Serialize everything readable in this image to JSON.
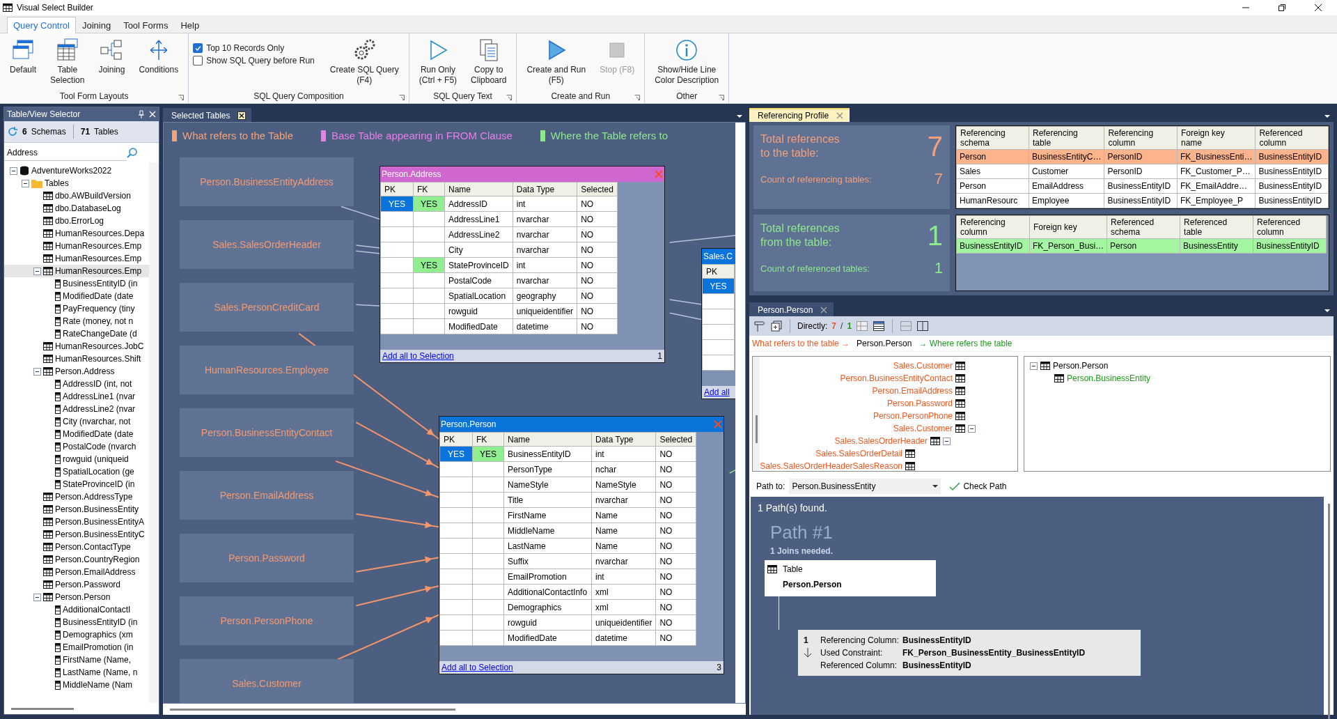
{
  "window": {
    "title": "Visual Select Builder"
  },
  "ribbon": {
    "tabs": [
      {
        "label": "Query Control",
        "selected": true
      },
      {
        "label": "Joining",
        "selected": false
      },
      {
        "label": "Tool Forms",
        "selected": false
      },
      {
        "label": "Help",
        "selected": false
      }
    ],
    "groups": [
      {
        "label": "Tool Form Layouts",
        "items": [
          {
            "kind": "button",
            "label": "Default",
            "disabled": false
          },
          {
            "kind": "button",
            "label": "Table\nSelection",
            "disabled": false
          },
          {
            "kind": "button",
            "label": "Joining",
            "disabled": false
          },
          {
            "kind": "button",
            "label": "Conditions",
            "disabled": false
          }
        ]
      },
      {
        "label": "SQL Query Composition",
        "items": [
          {
            "kind": "checkbox",
            "label": "Top 10 Records Only",
            "checked": true
          },
          {
            "kind": "checkbox",
            "label": "Show SQL Query before Run",
            "checked": false
          },
          {
            "kind": "button",
            "label": "Create SQL Query\n(F4)",
            "disabled": false
          }
        ]
      },
      {
        "label": "SQL Query Text",
        "items": [
          {
            "kind": "button",
            "label": "Run Only\n(Ctrl + F5)",
            "disabled": false
          },
          {
            "kind": "button",
            "label": "Copy to\nClipboard",
            "disabled": false
          }
        ]
      },
      {
        "label": "Create and Run",
        "items": [
          {
            "kind": "button",
            "label": "Create and Run\n(F5)",
            "disabled": false
          },
          {
            "kind": "button",
            "label": "Stop (F8)",
            "disabled": true
          }
        ]
      },
      {
        "label": "Other",
        "items": [
          {
            "kind": "button",
            "label": "Show/Hide Line\nColor Description",
            "disabled": false
          }
        ]
      }
    ]
  },
  "selector": {
    "title": "Table/View Selector",
    "schemas_count": "6",
    "schemas_label": "Schemas",
    "tables_count": "71",
    "tables_label": "Tables",
    "search": {
      "value": "Address"
    },
    "tree": [
      {
        "label": "AdventureWorks2022",
        "selected": false,
        "children": [
          {
            "label": "Tables",
            "selected": false,
            "children": [
              {
                "label": "dbo.AWBuildVersion",
                "selected": false
              },
              {
                "label": "dbo.DatabaseLog",
                "selected": false
              },
              {
                "label": "dbo.ErrorLog",
                "selected": false
              },
              {
                "label": "HumanResources.Depa",
                "selected": false
              },
              {
                "label": "HumanResources.Emp",
                "selected": false
              },
              {
                "label": "HumanResources.Emp",
                "selected": false
              },
              {
                "label": "HumanResources.Emp",
                "selected": true,
                "children": [
                  {
                    "label": "BusinessEntityID (in",
                    "selected": false
                  },
                  {
                    "label": "ModifiedDate (date",
                    "selected": false
                  },
                  {
                    "label": "PayFrequency (tiny",
                    "selected": false
                  },
                  {
                    "label": "Rate (money, not n",
                    "selected": false
                  },
                  {
                    "label": "RateChangeDate (d",
                    "selected": false
                  }
                ]
              },
              {
                "label": "HumanResources.JobC",
                "selected": false
              },
              {
                "label": "HumanResources.Shift",
                "selected": false
              },
              {
                "label": "Person.Address",
                "selected": false,
                "children": [
                  {
                    "label": "AddressID (int, not",
                    "selected": false
                  },
                  {
                    "label": "AddressLine1 (nvar",
                    "selected": false
                  },
                  {
                    "label": "AddressLine2 (nvar",
                    "selected": false
                  },
                  {
                    "label": "City (nvarchar, not",
                    "selected": false
                  },
                  {
                    "label": "ModifiedDate (date",
                    "selected": false
                  },
                  {
                    "label": "PostalCode (nvarch",
                    "selected": false
                  },
                  {
                    "label": "rowguid (uniqueid",
                    "selected": false
                  },
                  {
                    "label": "SpatialLocation (ge",
                    "selected": false
                  },
                  {
                    "label": "StateProvinceID (in",
                    "selected": false
                  }
                ]
              },
              {
                "label": "Person.AddressType",
                "selected": false
              },
              {
                "label": "Person.BusinessEntity",
                "selected": false
              },
              {
                "label": "Person.BusinessEntityA",
                "selected": false
              },
              {
                "label": "Person.BusinessEntityC",
                "selected": false
              },
              {
                "label": "Person.ContactType",
                "selected": false
              },
              {
                "label": "Person.CountryRegion",
                "selected": false
              },
              {
                "label": "Person.EmailAddress",
                "selected": false
              },
              {
                "label": "Person.Password",
                "selected": false
              },
              {
                "label": "Person.Person",
                "selected": false,
                "children": [
                  {
                    "label": "AdditionalContactI",
                    "selected": false
                  },
                  {
                    "label": "BusinessEntityID (in",
                    "selected": false
                  },
                  {
                    "label": "Demographics (xm",
                    "selected": false
                  },
                  {
                    "label": "EmailPromotion (in",
                    "selected": false
                  },
                  {
                    "label": "FirstName (Name,",
                    "selected": false
                  },
                  {
                    "label": "LastName (Name, n",
                    "selected": false
                  },
                  {
                    "label": "MiddleName (Nam",
                    "selected": false
                  }
                ]
              }
            ]
          }
        ]
      }
    ]
  },
  "center": {
    "tab": {
      "label": "Selected Tables",
      "selected": false
    },
    "legend": [
      {
        "label": "What refers to the Table",
        "color": "#f4a27a"
      },
      {
        "label": "Base Table appearing in FROM Clause",
        "color": "#e77fe7"
      },
      {
        "label": "Where the Table refers to",
        "color": "#8ee88e"
      }
    ],
    "nodes": [
      "Person.BusinessEntityAddress",
      "Sales.SalesOrderHeader",
      "Sales.PersonCreditCard",
      "HumanResources.Employee",
      "Person.BusinessEntityContact",
      "Person.EmailAddress",
      "Person.Password",
      "Person.PersonPhone",
      "Sales.Customer"
    ],
    "windows": [
      {
        "title": "Person.Address",
        "color": "#d066d0",
        "columns": [
          "PK",
          "FK",
          "Name",
          "Data Type",
          "Selected"
        ],
        "rows": [
          [
            "YES",
            "YES",
            "AddressID",
            "int",
            "NO"
          ],
          [
            "",
            "",
            "AddressLine1",
            "nvarchar",
            "NO"
          ],
          [
            "",
            "",
            "AddressLine2",
            "nvarchar",
            "NO"
          ],
          [
            "",
            "",
            "City",
            "nvarchar",
            "NO"
          ],
          [
            "",
            "YES",
            "StateProvinceID",
            "int",
            "NO"
          ],
          [
            "",
            "",
            "PostalCode",
            "nvarchar",
            "NO"
          ],
          [
            "",
            "",
            "SpatialLocation",
            "geography",
            "NO"
          ],
          [
            "",
            "",
            "rowguid",
            "uniqueidentifier",
            "NO"
          ],
          [
            "",
            "",
            "ModifiedDate",
            "datetime",
            "NO"
          ]
        ],
        "link": "Add all to Selection",
        "count": "1"
      },
      {
        "title": "Sales.C",
        "color": "#0a74da",
        "columns": [
          "PK"
        ],
        "rows": [
          [
            "YES"
          ]
        ],
        "link": "Add all"
      },
      {
        "title": "Person.Person",
        "color": "#0a74da",
        "columns": [
          "PK",
          "FK",
          "Name",
          "Data Type",
          "Selected"
        ],
        "rows": [
          [
            "YES",
            "YES",
            "BusinessEntityID",
            "int",
            "NO"
          ],
          [
            "",
            "",
            "PersonType",
            "nchar",
            "NO"
          ],
          [
            "",
            "",
            "NameStyle",
            "NameStyle",
            "NO"
          ],
          [
            "",
            "",
            "Title",
            "nvarchar",
            "NO"
          ],
          [
            "",
            "",
            "FirstName",
            "Name",
            "NO"
          ],
          [
            "",
            "",
            "MiddleName",
            "Name",
            "NO"
          ],
          [
            "",
            "",
            "LastName",
            "Name",
            "NO"
          ],
          [
            "",
            "",
            "Suffix",
            "nvarchar",
            "NO"
          ],
          [
            "",
            "",
            "EmailPromotion",
            "int",
            "NO"
          ],
          [
            "",
            "",
            "AdditionalContactInfo",
            "xml",
            "NO"
          ],
          [
            "",
            "",
            "Demographics",
            "xml",
            "NO"
          ],
          [
            "",
            "",
            "rowguid",
            "uniqueidentifier",
            "NO"
          ],
          [
            "",
            "",
            "ModifiedDate",
            "datetime",
            "NO"
          ]
        ],
        "link": "Add all to Selection",
        "count": "3"
      }
    ]
  },
  "profile": {
    "tab": {
      "label": "Referencing Profile",
      "selected": true
    },
    "sections": [
      {
        "kind": "to",
        "title": "Total references\nto the table:",
        "total": "7",
        "count_label": "Count of referencing tables:",
        "count": "7",
        "columns": [
          "Referencing\nschema",
          "Referencing\ntable",
          "Referencing\ncolumn",
          "Foreign key\nname",
          "Referenced\ncolumn"
        ],
        "rows": [
          {
            "cells": [
              "Person",
              "BusinessEntityC…",
              "PersonID",
              "FK_BusinessEnti…",
              "BusinessEntityID"
            ],
            "selected": true
          },
          {
            "cells": [
              "Sales",
              "Customer",
              "PersonID",
              "FK_Customer_P…",
              "BusinessEntityID"
            ],
            "selected": false
          },
          {
            "cells": [
              "Person",
              "EmailAddress",
              "BusinessEntityID",
              "FK_EmailAddre…",
              "BusinessEntityID"
            ],
            "selected": false
          },
          {
            "cells": [
              "HumanResourc",
              "Employee",
              "BusinessEntityID",
              "FK_Employee_P",
              "BusinessEntityID"
            ],
            "selected": false
          }
        ]
      },
      {
        "kind": "from",
        "title": "Total references\nfrom the table:",
        "total": "1",
        "count_label": "Count of referenced tables:",
        "count": "1",
        "columns": [
          "Referencing\ncolumn",
          "Foreign key",
          "Referenced\nschema",
          "Referenced\ntable",
          "Referenced\ncolumn"
        ],
        "rows": [
          {
            "cells": [
              "BusinessEntityID",
              "FK_Person_Busi…",
              "Person",
              "BusinessEntity",
              "BusinessEntityID"
            ],
            "selected": true
          }
        ]
      }
    ]
  },
  "relations": {
    "tab": {
      "label": "Person.Person",
      "selected": false
    },
    "toolbar": {
      "label": "Directly:",
      "to_count": "7",
      "separator": "/",
      "from_count": "1"
    },
    "legend": {
      "left": "What refers to the table →",
      "center": "Person.Person",
      "right": "→ Where refers the table"
    },
    "referencing_tree": [
      {
        "label": "Sales.Customer"
      },
      {
        "label": "Person.BusinessEntityContact"
      },
      {
        "label": "Person.EmailAddress"
      },
      {
        "label": "Person.Password"
      },
      {
        "label": "Person.PersonPhone"
      },
      {
        "label": "Sales.Customer",
        "children": [
          {
            "label": "Sales.SalesOrderHeader",
            "children": [
              {
                "label": "Sales.SalesOrderDetail"
              },
              {
                "label": "Sales.SalesOrderHeaderSalesReason"
              }
            ]
          }
        ]
      }
    ],
    "referenced_tree": [
      {
        "label": "Person.Person",
        "children": [
          {
            "label": "Person.BusinessEntity"
          }
        ]
      }
    ],
    "path_to": {
      "label": "Path to:",
      "value": "Person.BusinessEntity",
      "button": "Check Path"
    },
    "result": {
      "summary": "1 Path(s) found.",
      "path_title": "Path #1",
      "joins": "1 Joins needed.",
      "table_card": {
        "label": "Table",
        "name": "Person.Person"
      },
      "join": {
        "index": "1",
        "rows": [
          {
            "label": "Referencing Column:",
            "value": "BusinessEntityID"
          },
          {
            "label": "Used Constraint:",
            "value": "FK_Person_BusinessEntity_BusinessEntityID"
          },
          {
            "label": "Referenced Column:",
            "value": "BusinessEntityID"
          }
        ]
      }
    }
  }
}
